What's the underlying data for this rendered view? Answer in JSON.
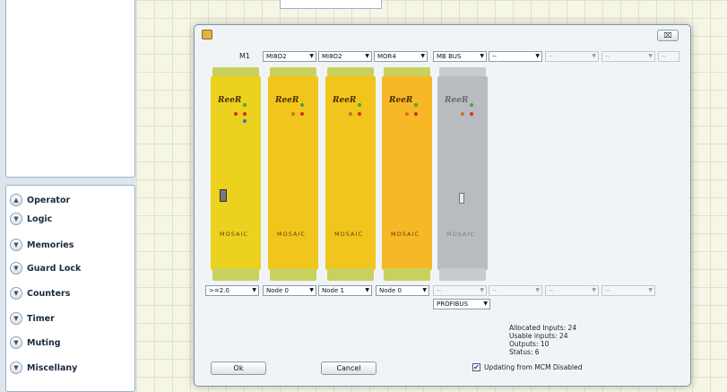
{
  "sidebar": {
    "top_ghost": "",
    "operator_label": "Operator",
    "items": [
      {
        "label": "Logic"
      },
      {
        "label": "Memories"
      },
      {
        "label": "Guard Lock"
      },
      {
        "label": "Counters"
      },
      {
        "label": "Timer"
      },
      {
        "label": "Muting"
      },
      {
        "label": "Miscellany"
      }
    ]
  },
  "dialog": {
    "close_label": "⌧",
    "m1_label": "M1",
    "top_selects": [
      {
        "value": "MI8O2"
      },
      {
        "value": "MI8O2"
      },
      {
        "value": "MOR4"
      },
      {
        "value": "MB BUS"
      },
      {
        "value": "--"
      },
      {
        "value": "--"
      },
      {
        "value": "--"
      },
      {
        "value": "--"
      }
    ],
    "modules": [
      {
        "brand": "ReeR",
        "footer": "MOSAIC"
      },
      {
        "brand": "ReeR",
        "footer": "MOSAIC"
      },
      {
        "brand": "ReeR",
        "footer": "MOSAIC"
      },
      {
        "brand": "ReeR",
        "footer": "MOSAIC"
      },
      {
        "brand": "ReeR",
        "footer": "MOSAIC"
      }
    ],
    "bottom_selects": [
      {
        "value": ">=2.0"
      },
      {
        "value": "Node 0"
      },
      {
        "value": "Node 1"
      },
      {
        "value": "Node 0"
      },
      {
        "value": "--"
      },
      {
        "value": "--"
      },
      {
        "value": "--"
      },
      {
        "value": "--"
      }
    ],
    "fieldbus": "PROFIBUS",
    "info": {
      "allocated_inputs": "Allocated Inputs: 24",
      "usable_inputs": "Usable inputs: 24",
      "outputs": "Outputs: 10",
      "status": "Status: 6"
    },
    "ok_label": "Ok",
    "cancel_label": "Cancel",
    "checkbox_label": "Updating from MCM Disabled",
    "checkbox_checked": true
  },
  "colors": {
    "module_yellow": "#f2c51c",
    "module_gray": "#b8bcc0",
    "grid": "#f6f6e6"
  }
}
